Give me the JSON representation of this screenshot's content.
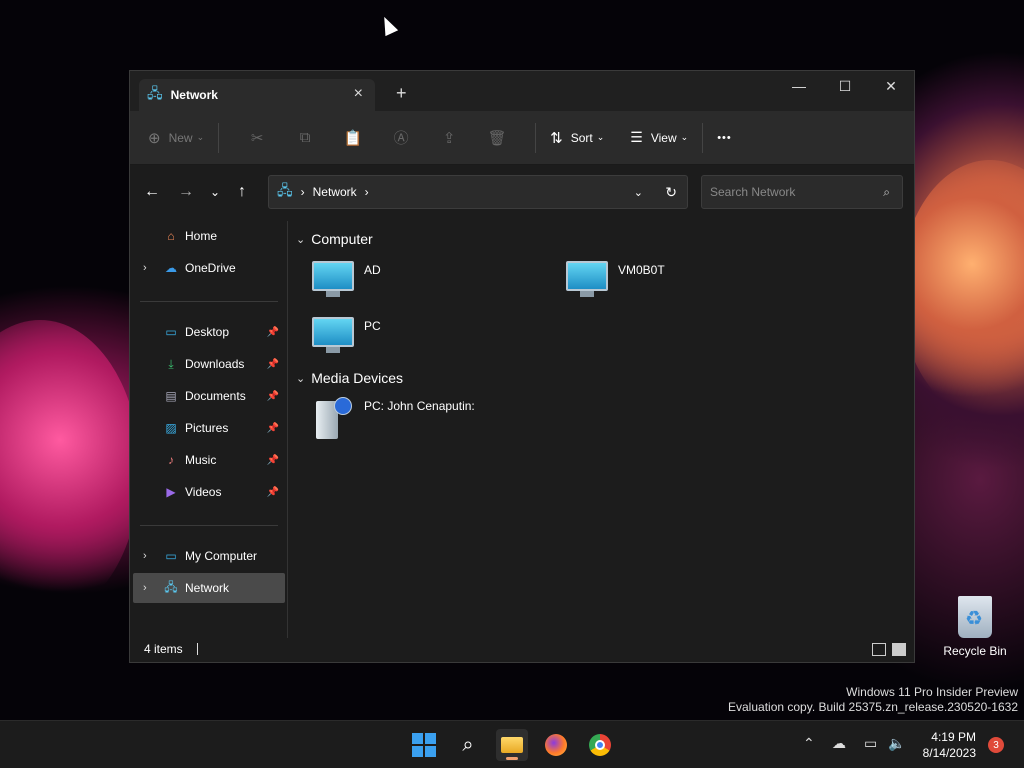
{
  "window": {
    "tab_title": "Network",
    "new_tab_symbol": "+",
    "controls": {
      "minimize": "—",
      "maximize": "☐",
      "close": "✕"
    }
  },
  "toolbar": {
    "new_label": "New",
    "sort_label": "Sort",
    "view_label": "View",
    "more_label": "•••"
  },
  "address_bar": {
    "segments": [
      "Network"
    ],
    "separator": "›"
  },
  "search": {
    "placeholder": "Search Network"
  },
  "sidebar": {
    "quick": [
      {
        "label": "Home",
        "icon": "home-icon"
      },
      {
        "label": "OneDrive",
        "icon": "cloud-icon"
      }
    ],
    "pinned": [
      {
        "label": "Desktop",
        "icon": "desktop-icon"
      },
      {
        "label": "Downloads",
        "icon": "download-icon"
      },
      {
        "label": "Documents",
        "icon": "document-icon"
      },
      {
        "label": "Pictures",
        "icon": "picture-icon"
      },
      {
        "label": "Music",
        "icon": "music-icon"
      },
      {
        "label": "Videos",
        "icon": "video-icon"
      }
    ],
    "bottom": [
      {
        "label": "My Computer",
        "icon": "computer-icon"
      },
      {
        "label": "Network",
        "icon": "network-icon",
        "selected": true
      }
    ]
  },
  "content": {
    "groups": [
      {
        "title": "Computer",
        "items": [
          "AD",
          "VM0B0T",
          "PC"
        ]
      },
      {
        "title": "Media Devices",
        "items": [
          "PC: John Cenaputin:"
        ]
      }
    ]
  },
  "status": {
    "item_count": "4 items"
  },
  "desktop": {
    "recycle_bin_label": "Recycle Bin",
    "watermark_line1": "Windows 11 Pro Insider Preview",
    "watermark_line2": "Evaluation copy. Build 25375.zn_release.230520-1632"
  },
  "taskbar": {
    "time": "4:19 PM",
    "date": "8/14/2023",
    "notification_count": "3"
  },
  "colors": {
    "window_bg": "#1c1c1c",
    "toolbar_bg": "#2b2b2b",
    "selection_bg": "#4a4a4a",
    "badge": "#e04a3a"
  }
}
